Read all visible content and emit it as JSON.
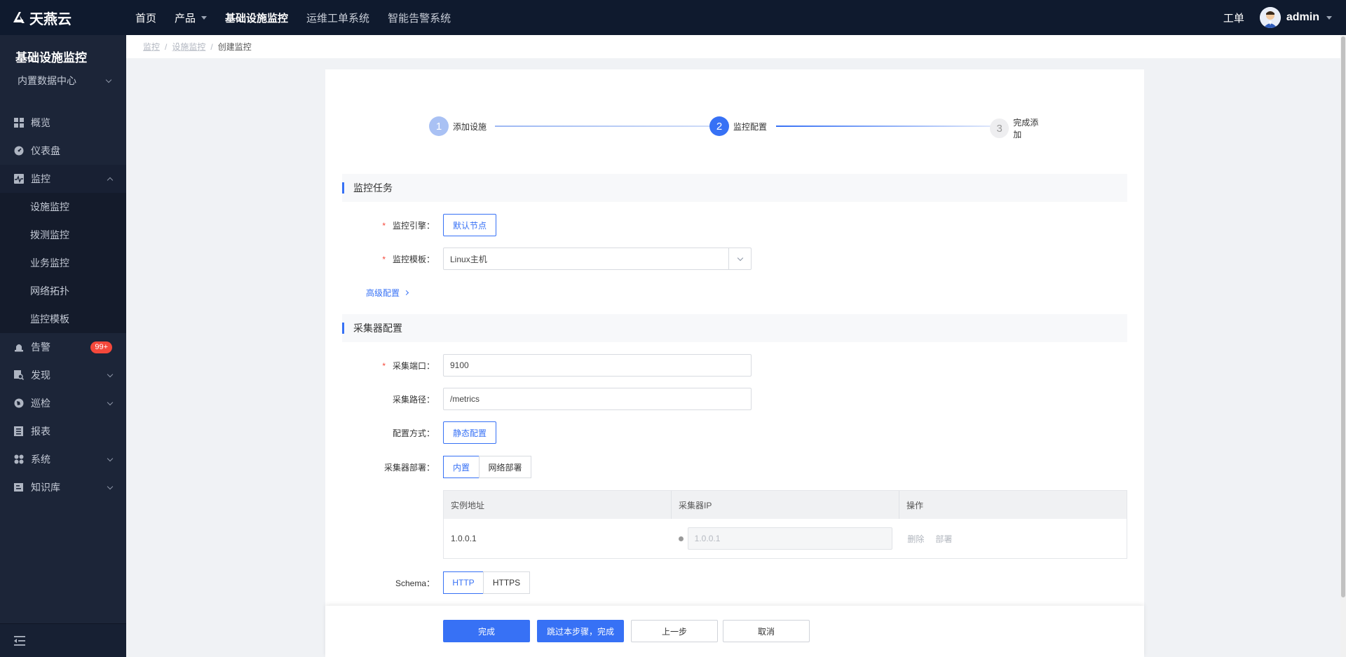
{
  "app": {
    "brand": "天燕云",
    "nav": [
      {
        "label": "首页"
      },
      {
        "label": "产品"
      },
      {
        "label": "基础设施监控"
      },
      {
        "label": "运维工单系统"
      },
      {
        "label": "智能告警系统"
      }
    ],
    "ticket_label": "工单",
    "username": "admin"
  },
  "sidebar": {
    "title": "基础设施监控",
    "datacenter": "内置数据中心",
    "menu": {
      "overview": "概览",
      "dashboard": "仪表盘",
      "monitor": "监控",
      "monitor_sub": [
        "设施监控",
        "拨测监控",
        "业务监控",
        "网络拓扑",
        "监控模板"
      ],
      "alarm": "告警",
      "alarm_badge": "99+",
      "discover": "发现",
      "inspect": "巡检",
      "report": "报表",
      "system": "系统",
      "knowledge": "知识库"
    }
  },
  "breadcrumb": [
    "监控",
    "设施监控",
    "创建监控"
  ],
  "steps": [
    {
      "num": "1",
      "label": "添加设施"
    },
    {
      "num": "2",
      "label": "监控配置"
    },
    {
      "num": "3",
      "label": "完成添加"
    }
  ],
  "task_section": {
    "title": "监控任务",
    "engine_label": "监控引擎：",
    "engine_value": "默认节点",
    "template_label": "监控模板：",
    "template_value": "Linux主机",
    "advanced_link": "高级配置"
  },
  "collector_section": {
    "title": "采集器配置",
    "port_label": "采集端口：",
    "port_value": "9100",
    "path_label": "采集路径：",
    "path_value": "/metrics",
    "mode_label": "配置方式：",
    "mode_value": "静态配置",
    "deploy_label": "采集器部署：",
    "deploy_options": [
      "内置",
      "网络部署"
    ],
    "table": {
      "headers": [
        "实例地址",
        "采集器IP",
        "操作"
      ],
      "rows": [
        {
          "instance": "1.0.0.1",
          "collector_ip": "1.0.0.1",
          "actions": [
            "删除",
            "部署"
          ]
        }
      ]
    },
    "schema_label": "Schema：",
    "schema_options": [
      "HTTP",
      "HTTPS"
    ]
  },
  "footer": {
    "finish": "完成",
    "skip_finish": "跳过本步骤，完成",
    "prev": "上一步",
    "cancel": "取消"
  }
}
